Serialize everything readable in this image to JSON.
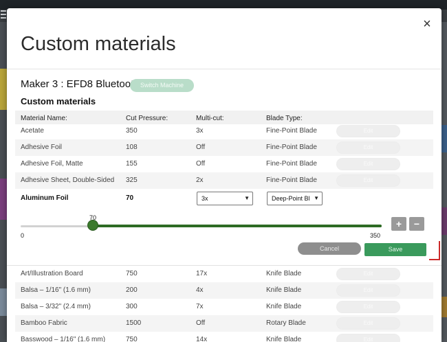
{
  "dialog": {
    "title": "Custom materials",
    "close_glyph": "×",
    "machine": "Maker 3 : EFD8 Bluetooth",
    "switch_label": "Switch Machine",
    "section_title": "Custom materials"
  },
  "columns": {
    "name": "Material Name:",
    "pressure": "Cut Pressure:",
    "multicut": "Multi-cut:",
    "blade": "Blade Type:"
  },
  "rows_top": [
    {
      "name": "Acetate",
      "pressure": "350",
      "multicut": "3x",
      "blade": "Fine-Point Blade",
      "edit": "Edit"
    },
    {
      "name": "Adhesive Foil",
      "pressure": "108",
      "multicut": "Off",
      "blade": "Fine-Point Blade",
      "edit": "Edit"
    },
    {
      "name": "Adhesive Foil, Matte",
      "pressure": "155",
      "multicut": "Off",
      "blade": "Fine-Point Blade",
      "edit": "Edit"
    },
    {
      "name": "Adhesive Sheet, Double-Sided",
      "pressure": "325",
      "multicut": "2x",
      "blade": "Fine-Point Blade",
      "edit": "Edit"
    }
  ],
  "active": {
    "name": "Aluminum Foil",
    "pressure": "70",
    "multicut_selected": "3x",
    "blade_selected": "Deep-Point Bl",
    "slider": {
      "value": 70,
      "value_label": "70",
      "min": 0,
      "max": 350,
      "min_label": "0",
      "max_label": "350"
    },
    "plus_label": "+",
    "minus_label": "−",
    "cancel_label": "Cancel",
    "save_label": "Save"
  },
  "rows_bottom": [
    {
      "name": "Art/Illustration Board",
      "pressure": "750",
      "multicut": "17x",
      "blade": "Knife Blade",
      "edit": "Edit"
    },
    {
      "name": "Balsa – 1/16\" (1.6 mm)",
      "pressure": "200",
      "multicut": "4x",
      "blade": "Knife Blade",
      "edit": "Edit"
    },
    {
      "name": "Balsa – 3/32\" (2.4 mm)",
      "pressure": "300",
      "multicut": "7x",
      "blade": "Knife Blade",
      "edit": "Edit"
    },
    {
      "name": "Bamboo Fabric",
      "pressure": "1500",
      "multicut": "Off",
      "blade": "Rotary Blade",
      "edit": "Edit"
    },
    {
      "name": "Basswood – 1/16\" (1.6 mm)",
      "pressure": "750",
      "multicut": "14x",
      "blade": "Knife Blade",
      "edit": "Edit"
    }
  ],
  "colors": {
    "accent_green": "#3a9a5c",
    "slider_green": "#2d6b24",
    "switch_green": "#b9ddc9",
    "highlight_red": "#cc2a2a"
  }
}
